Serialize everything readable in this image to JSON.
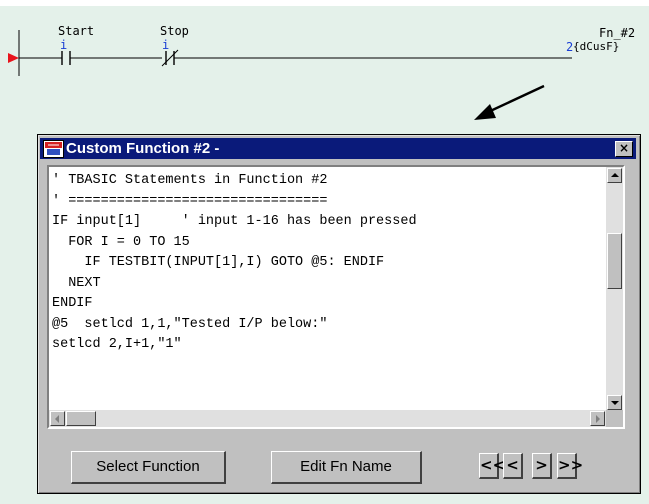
{
  "ladder": {
    "contacts": [
      {
        "label": "Start",
        "index": "i"
      },
      {
        "label": "Stop",
        "index": "i"
      }
    ],
    "coil": {
      "label": "Fn_#2",
      "index": "2",
      "tag": "{dCusF}"
    }
  },
  "dialog": {
    "title": "Custom Function #2 -",
    "close_label": "×",
    "code_lines": [
      "' TBASIC Statements in Function #2",
      "' ================================",
      "IF input[1]     ' input 1-16 has been pressed",
      "  FOR I = 0 TO 15",
      "    IF TESTBIT(INPUT[1],I) GOTO @5: ENDIF",
      "  NEXT",
      "ENDIF",
      "@5  setlcd 1,1,\"Tested I/P below:\"",
      "setlcd 2,I+1,\"1\""
    ],
    "buttons": {
      "select_function": "Select Function",
      "edit_fn_name": "Edit Fn Name",
      "first": "<<",
      "prev": "<",
      "next": ">",
      "last": ">>"
    }
  },
  "colors": {
    "ladder_bg": "#e4f1ea",
    "title_bar": "#0a1a7a",
    "power_rail_arrow": "#e8141c",
    "index_blue": "#1a3fd4"
  }
}
